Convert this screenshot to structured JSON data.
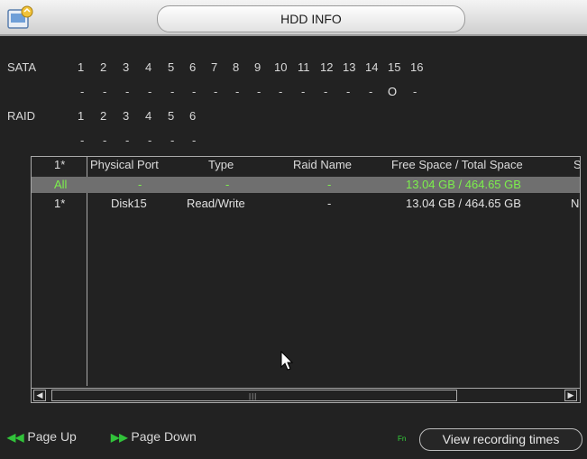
{
  "window": {
    "title": "HDD INFO"
  },
  "sata": {
    "label": "SATA",
    "ports": [
      "1",
      "2",
      "3",
      "4",
      "5",
      "6",
      "7",
      "8",
      "9",
      "10",
      "11",
      "12",
      "13",
      "14",
      "15",
      "16"
    ],
    "states": [
      "-",
      "-",
      "-",
      "-",
      "-",
      "-",
      "-",
      "-",
      "-",
      "-",
      "-",
      "-",
      "-",
      "-",
      "O",
      "-"
    ]
  },
  "raid": {
    "label": "RAID",
    "ports": [
      "1",
      "2",
      "3",
      "4",
      "5",
      "6"
    ],
    "states": [
      "-",
      "-",
      "-",
      "-",
      "-",
      "-"
    ]
  },
  "table": {
    "columns": [
      "1*",
      "Physical Port",
      "Type",
      "Raid Name",
      "Free Space / Total Space",
      "S"
    ],
    "rows": [
      {
        "index": "All",
        "port": "-",
        "type": "-",
        "raid": "-",
        "space": "13.04 GB / 464.65 GB",
        "status": "",
        "selected": true
      },
      {
        "index": "1*",
        "port": "Disk15",
        "type": "Read/Write",
        "raid": "-",
        "space": "13.04 GB / 464.65 GB",
        "status": "No",
        "selected": false
      }
    ]
  },
  "footer": {
    "page_up": "Page Up",
    "page_down": "Page Down",
    "fn": "Fn",
    "view_button": "View recording times"
  },
  "colors": {
    "accent_green": "#7cf04c",
    "background": "#222222",
    "border": "#a9a9a9"
  }
}
